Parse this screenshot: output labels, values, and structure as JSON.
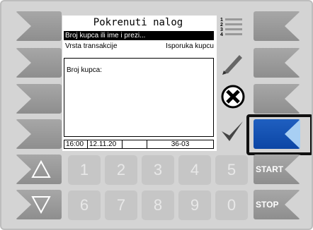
{
  "screen": {
    "title": "Pokrenuti nalog",
    "selected_item": "Broj kupca ili ime i prezi...",
    "transaction_label": "Vrsta transakcije",
    "transaction_value": "Isporuka kupcu",
    "text_label": "Broj kupca:",
    "status_time": "16:00",
    "status_date": "12.11.20",
    "status_empty": "",
    "status_code": "36-03"
  },
  "list_icon_numbers": [
    "1",
    "2",
    "3",
    "4"
  ],
  "numpad": {
    "row1": [
      "1",
      "2",
      "3",
      "4",
      "5"
    ],
    "row2": [
      "6",
      "7",
      "8",
      "9",
      "0"
    ]
  },
  "buttons": {
    "start_label": "START",
    "stop_label": "STOP"
  },
  "icons": {
    "list": "list-icon",
    "edit": "pencil-icon",
    "delete": "cancel-x-icon",
    "confirm": "checkmark-icon",
    "up": "arrow-up-icon",
    "down": "arrow-down-icon"
  },
  "colors": {
    "active_key": "#0c46a5",
    "active_notch": "#a8cff3",
    "panel": "#d4d4d4"
  }
}
